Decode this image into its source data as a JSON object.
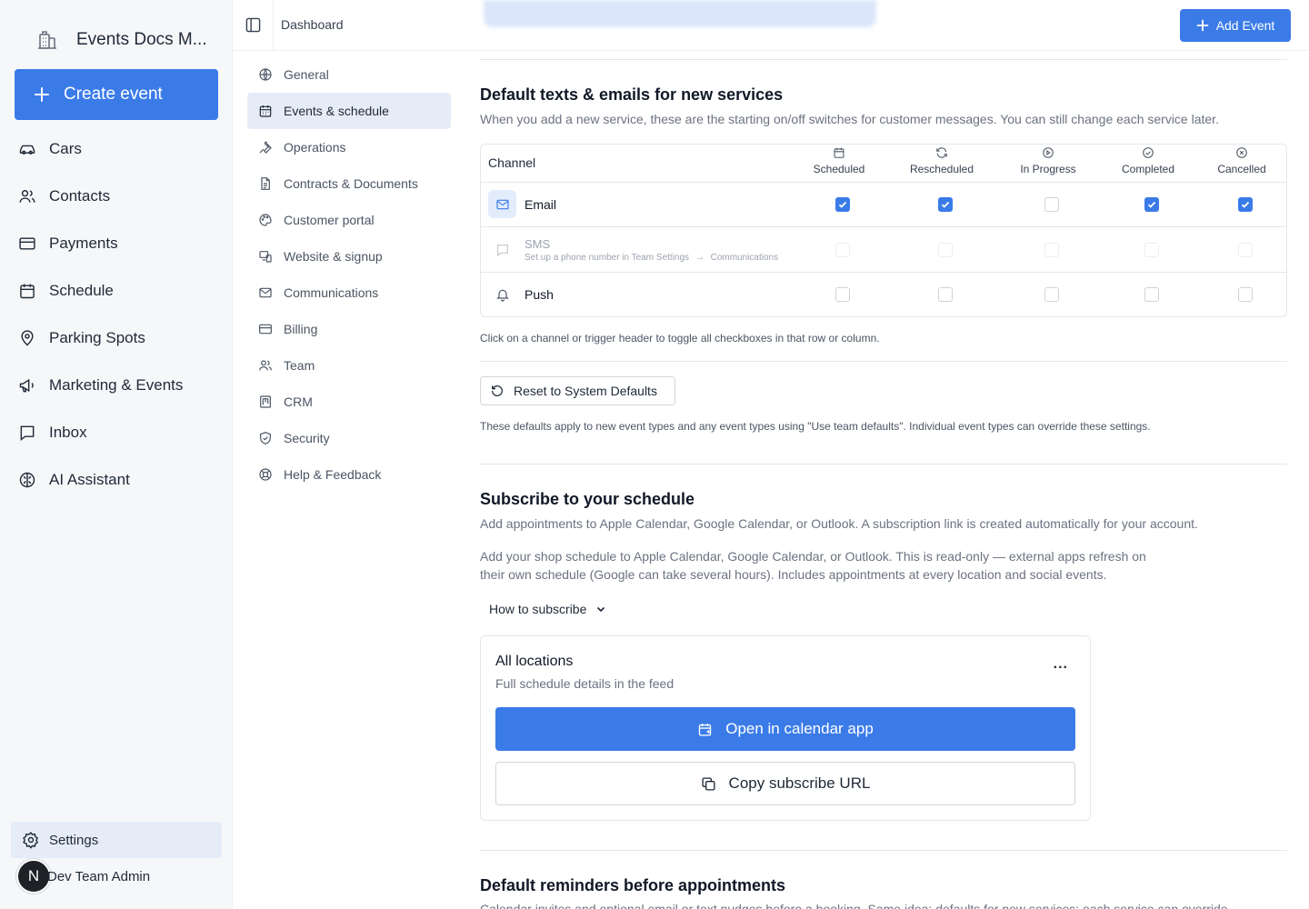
{
  "app": {
    "name": "Events Docs M...",
    "create_button": "Create event"
  },
  "sidebar": {
    "items": [
      {
        "label": "Cars",
        "icon": "car-icon"
      },
      {
        "label": "Contacts",
        "icon": "users-icon"
      },
      {
        "label": "Payments",
        "icon": "credit-card-icon"
      },
      {
        "label": "Schedule",
        "icon": "calendar-icon"
      },
      {
        "label": "Parking Spots",
        "icon": "map-pin-icon"
      },
      {
        "label": "Marketing & Events",
        "icon": "megaphone-icon"
      },
      {
        "label": "Inbox",
        "icon": "inbox-icon"
      },
      {
        "label": "AI Assistant",
        "icon": "brain-icon"
      }
    ],
    "settings_label": "Settings",
    "user": {
      "initial": "N",
      "name": "Dev Team Admin"
    }
  },
  "header": {
    "breadcrumb": "Dashboard",
    "add_event": "Add Event"
  },
  "settings_nav": {
    "items": [
      {
        "label": "General",
        "icon": "globe-icon"
      },
      {
        "label": "Events & schedule",
        "icon": "calendar-icon",
        "active": true
      },
      {
        "label": "Operations",
        "icon": "wrench-icon"
      },
      {
        "label": "Contracts & Documents",
        "icon": "file-icon"
      },
      {
        "label": "Customer portal",
        "icon": "palette-icon"
      },
      {
        "label": "Website & signup",
        "icon": "web-icon"
      },
      {
        "label": "Communications",
        "icon": "mail-icon"
      },
      {
        "label": "Billing",
        "icon": "credit-card-icon"
      },
      {
        "label": "Team",
        "icon": "users-icon"
      },
      {
        "label": "CRM",
        "icon": "crm-icon"
      },
      {
        "label": "Security",
        "icon": "shield-icon"
      },
      {
        "label": "Help & Feedback",
        "icon": "lifebuoy-icon"
      }
    ]
  },
  "defaults_section": {
    "title": "Default texts & emails for new services",
    "description": "When you add a new service, these are the starting on/off switches for customer messages. You can still change each service later.",
    "channel_header": "Channel",
    "triggers": [
      {
        "label": "Scheduled",
        "icon": "calendar-icon"
      },
      {
        "label": "Rescheduled",
        "icon": "refresh-icon"
      },
      {
        "label": "In Progress",
        "icon": "play-circle-icon"
      },
      {
        "label": "Completed",
        "icon": "check-circle-icon"
      },
      {
        "label": "Cancelled",
        "icon": "x-circle-icon"
      }
    ],
    "channels": [
      {
        "name": "Email",
        "icon": "mail-icon",
        "checked": [
          true,
          true,
          false,
          true,
          true
        ],
        "disabled": false
      },
      {
        "name": "SMS",
        "icon": "message-icon",
        "hint": "Set up a phone number in Team Settings",
        "hint_arrow": "→",
        "hint_link": "Communications",
        "checked": [
          false,
          false,
          false,
          false,
          false
        ],
        "disabled": true
      },
      {
        "name": "Push",
        "icon": "bell-icon",
        "checked": [
          false,
          false,
          false,
          false,
          false
        ],
        "disabled": false
      }
    ],
    "toggle_hint": "Click on a channel or trigger header to toggle all checkboxes in that row or column.",
    "reset_button": "Reset to System Defaults",
    "footnote": "These defaults apply to new event types and any event types using \"Use team defaults\". Individual event types can override these settings."
  },
  "subscribe_section": {
    "title": "Subscribe to your schedule",
    "description": "Add appointments to Apple Calendar, Google Calendar, or Outlook. A subscription link is created automatically for your account.",
    "details_line1": "Add your shop schedule to Apple Calendar, Google Calendar, or Outlook. This is read-only — external apps refresh on",
    "details_line2": "their own schedule (Google can take several hours). Includes appointments at every location and social events.",
    "how_to": "How to subscribe",
    "card": {
      "title": "All locations",
      "subtitle": "Full schedule details in the feed",
      "more": "...",
      "open_button": "Open in calendar app",
      "copy_button": "Copy subscribe URL"
    }
  },
  "reminders_section": {
    "title": "Default reminders before appointments",
    "description": "Calendar invites and optional email or text nudges before a booking. Same idea: defaults for new services; each service can override"
  },
  "colors": {
    "accent": "#3b7be8",
    "sidebar_bg": "#f6f7f9",
    "active_bg": "#e6ecf7"
  }
}
